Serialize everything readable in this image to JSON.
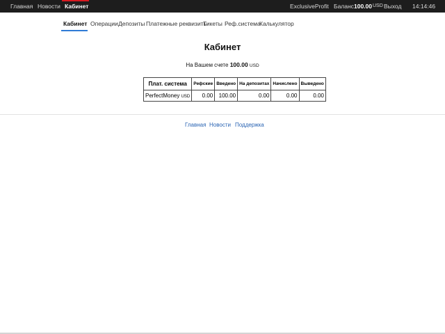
{
  "topbar": {
    "nav": [
      "Главная",
      "Новости",
      "Кабинет"
    ],
    "brand": "ExclusiveProfit",
    "balance_label": "Баланс",
    "balance_amount": "100.00",
    "balance_currency": "USD",
    "logout": "Выход",
    "clock": "14:14:46",
    "accent_color": "#d71920"
  },
  "subnav": {
    "items": [
      "Кабинет",
      "Операции",
      "Депозиты",
      "Платежные реквизиты",
      "Тикеты",
      "Реф.система",
      "Калькулятор"
    ],
    "active": "Кабинет",
    "accent_color": "#2f7bd6"
  },
  "page": {
    "title": "Кабинет",
    "balance_prefix": "На Вашем счете",
    "balance_amount": "100.00",
    "balance_currency": "USD"
  },
  "table": {
    "headers": [
      "Плат. система",
      "Рефские",
      "Введено",
      "На депозитах",
      "Начислено",
      "Выведено"
    ],
    "rows": [
      {
        "system": "PerfectMoney",
        "currency": "USD",
        "values": [
          "0.00",
          "100.00",
          "0.00",
          "0.00",
          "0.00"
        ]
      }
    ]
  },
  "footer": {
    "links": [
      "Главная",
      "Новости",
      "Поддержка"
    ],
    "link_color": "#2a64b3"
  }
}
